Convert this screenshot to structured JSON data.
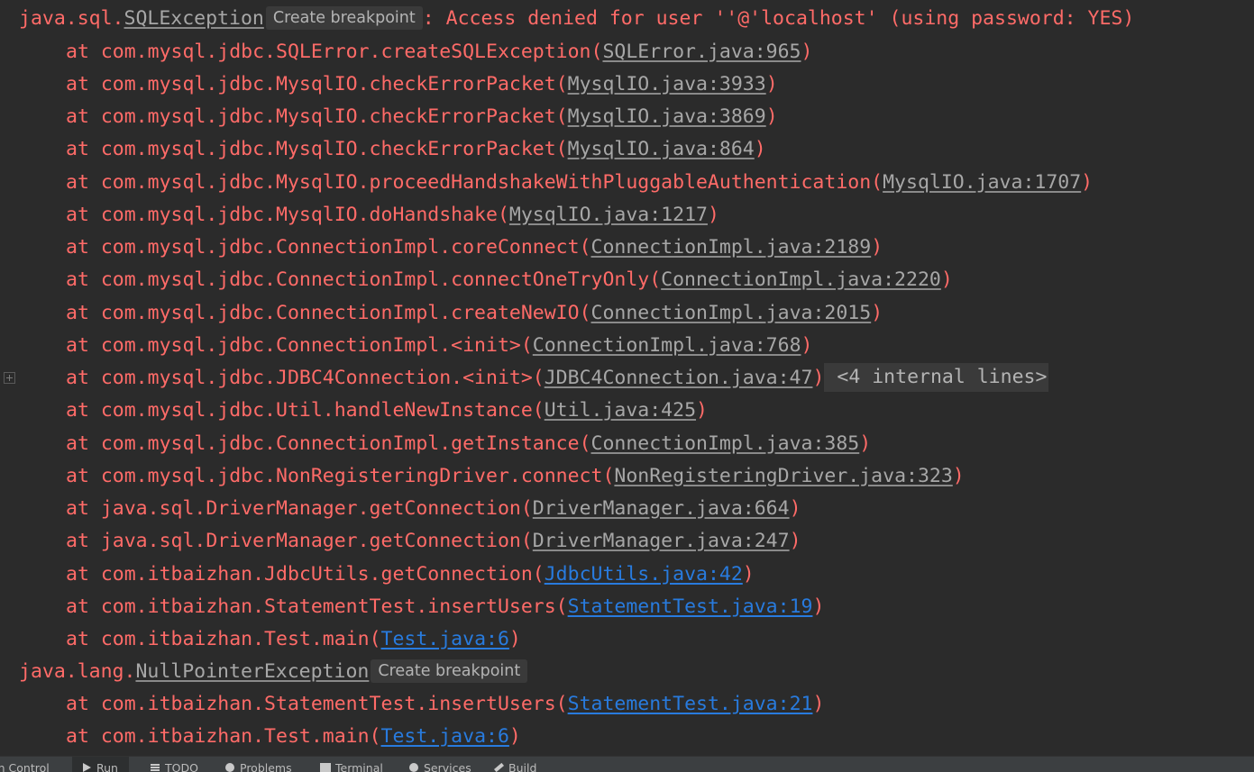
{
  "console": {
    "exception1": {
      "package": "java.sql.",
      "class_name": "SQLException",
      "breakpoint_label": "Create breakpoint",
      "message": ": Access denied for user ''@'localhost' (using password: YES)"
    },
    "frames1": [
      {
        "call": "com.mysql.jdbc.SQLError.createSQLException",
        "location": "SQLError.java:965"
      },
      {
        "call": "com.mysql.jdbc.MysqlIO.checkErrorPacket",
        "location": "MysqlIO.java:3933"
      },
      {
        "call": "com.mysql.jdbc.MysqlIO.checkErrorPacket",
        "location": "MysqlIO.java:3869"
      },
      {
        "call": "com.mysql.jdbc.MysqlIO.checkErrorPacket",
        "location": "MysqlIO.java:864"
      },
      {
        "call": "com.mysql.jdbc.MysqlIO.proceedHandshakeWithPluggableAuthentication",
        "location": "MysqlIO.java:1707"
      },
      {
        "call": "com.mysql.jdbc.MysqlIO.doHandshake",
        "location": "MysqlIO.java:1217"
      },
      {
        "call": "com.mysql.jdbc.ConnectionImpl.coreConnect",
        "location": "ConnectionImpl.java:2189"
      },
      {
        "call": "com.mysql.jdbc.ConnectionImpl.connectOneTryOnly",
        "location": "ConnectionImpl.java:2220"
      },
      {
        "call": "com.mysql.jdbc.ConnectionImpl.createNewIO",
        "location": "ConnectionImpl.java:2015"
      },
      {
        "call": "com.mysql.jdbc.ConnectionImpl.<init>",
        "location": "ConnectionImpl.java:768"
      },
      {
        "call": "com.mysql.jdbc.JDBC4Connection.<init>",
        "location": "JDBC4Connection.java:47",
        "folded": "<4 internal lines>"
      },
      {
        "call": "com.mysql.jdbc.Util.handleNewInstance",
        "location": "Util.java:425"
      },
      {
        "call": "com.mysql.jdbc.ConnectionImpl.getInstance",
        "location": "ConnectionImpl.java:385"
      },
      {
        "call": "com.mysql.jdbc.NonRegisteringDriver.connect",
        "location": "NonRegisteringDriver.java:323"
      },
      {
        "call": "java.sql.DriverManager.getConnection",
        "location": "DriverManager.java:664"
      },
      {
        "call": "java.sql.DriverManager.getConnection",
        "location": "DriverManager.java:247"
      },
      {
        "call": "com.itbaizhan.JdbcUtils.getConnection",
        "location": "JdbcUtils.java:42",
        "user_code": true
      },
      {
        "call": "com.itbaizhan.StatementTest.insertUsers",
        "location": "StatementTest.java:19",
        "user_code": true
      },
      {
        "call": "com.itbaizhan.Test.main",
        "location": "Test.java:6",
        "user_code": true
      }
    ],
    "exception2": {
      "package": "java.lang.",
      "class_name": "NullPointerException",
      "breakpoint_label": "Create breakpoint"
    },
    "frames2": [
      {
        "call": "com.itbaizhan.StatementTest.insertUsers",
        "location": "StatementTest.java:21",
        "user_code": true
      },
      {
        "call": "com.itbaizhan.Test.main",
        "location": "Test.java:6",
        "user_code": true
      }
    ],
    "at_prefix": "at ",
    "paren_open": "(",
    "paren_close": ")"
  },
  "toolwindow_tabs": [
    {
      "label": "on Control",
      "icon": "none"
    },
    {
      "label": "Run",
      "icon": "run-icon",
      "active": true
    },
    {
      "label": "TODO",
      "icon": "todo-icon"
    },
    {
      "label": "Problems",
      "icon": "problems-icon"
    },
    {
      "label": "Terminal",
      "icon": "terminal-icon"
    },
    {
      "label": "Services",
      "icon": "services-icon"
    },
    {
      "label": "Build",
      "icon": "build-icon"
    }
  ]
}
